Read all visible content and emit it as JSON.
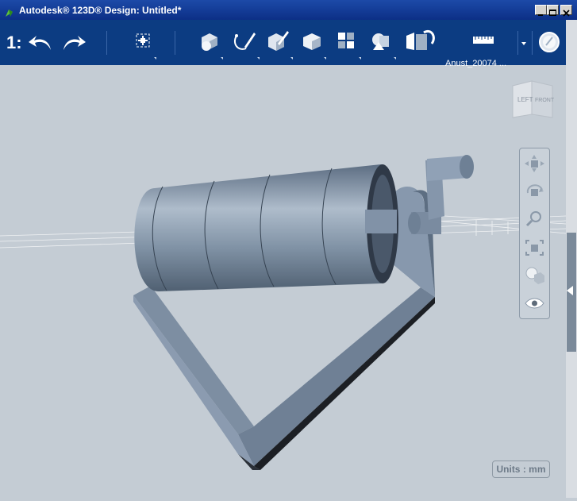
{
  "window": {
    "title": "Autodesk® 123D® Design: Untitled*"
  },
  "toolbar": {
    "logo_text": "1:",
    "undo": "undo-icon",
    "redo": "redo-icon",
    "user_label": "Anust_20074 ...",
    "help": "help-icon"
  },
  "viewcube": {
    "left": "LEFT",
    "front": "FRONT"
  },
  "navbar": {
    "items": [
      "pan-icon",
      "orbit-icon",
      "zoom-icon",
      "fit-icon",
      "material-icon",
      "visibility-icon"
    ]
  },
  "units": {
    "label": "Units : mm"
  },
  "colors": {
    "titlebar": "#0c2f86",
    "toolbar": "#0c3c82",
    "canvas": "#c4ccd4",
    "model": "#73859a"
  }
}
